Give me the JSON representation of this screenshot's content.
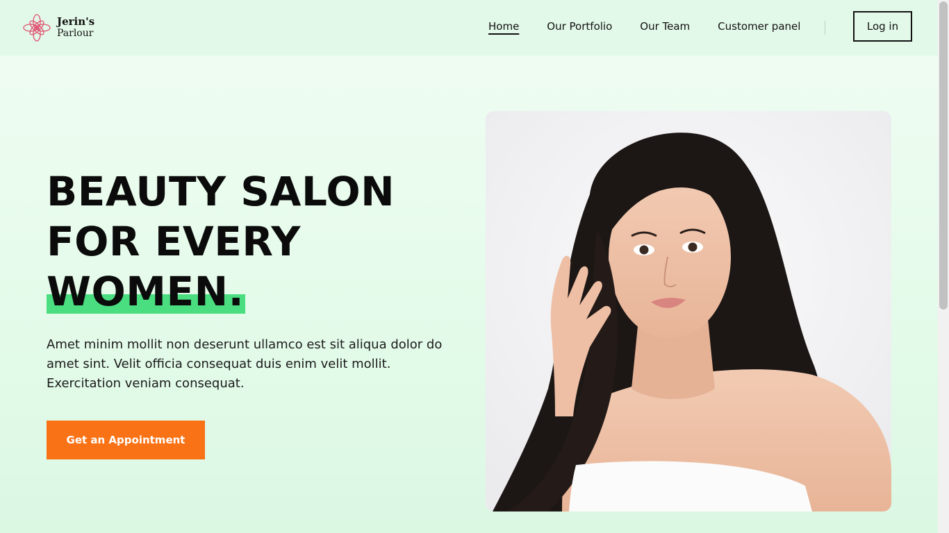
{
  "brand": {
    "line1": "Jerin's",
    "line2": "Parlour",
    "logo_icon": "flower-icon",
    "logo_color": "#e04f6f"
  },
  "nav": {
    "items": [
      {
        "label": "Home",
        "active": true
      },
      {
        "label": "Our Portfolio",
        "active": false
      },
      {
        "label": "Our Team",
        "active": false
      },
      {
        "label": "Customer panel",
        "active": false
      }
    ],
    "login_label": "Log in"
  },
  "hero": {
    "title_line1": "BEAUTY SALON",
    "title_line2": "FOR EVERY",
    "title_line3": "WOMEN.",
    "description": "Amet minim mollit non deserunt ullamco est sit aliqua dolor do amet sint. Velit officia consequat duis enim velit mollit. Exercitation veniam consequat.",
    "cta_label": "Get an Appointment",
    "image_alt": "woman-portrait"
  },
  "colors": {
    "accent_orange": "#f97316",
    "highlight_green": "#4ade80",
    "background": "#e6fbeb"
  }
}
